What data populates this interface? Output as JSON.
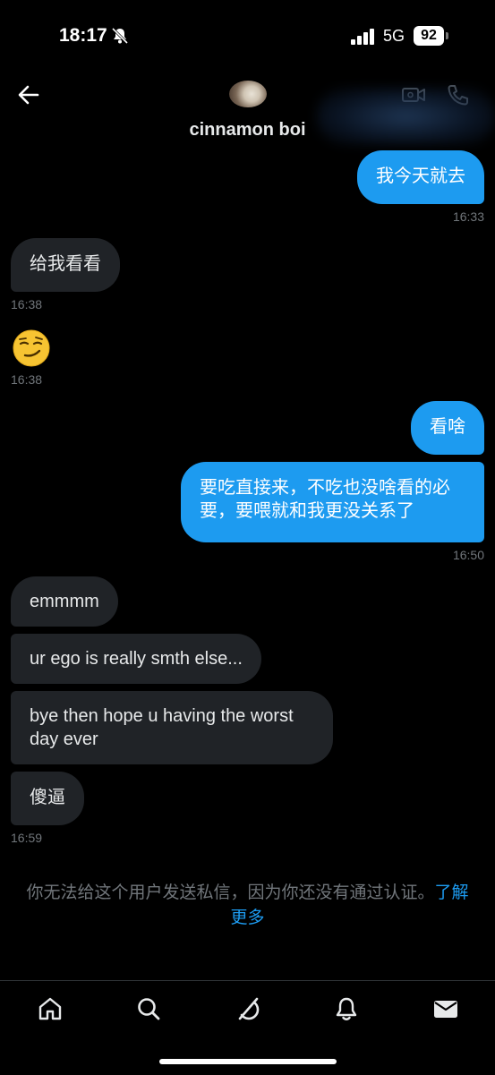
{
  "status_bar": {
    "time": "18:17",
    "network": "5G",
    "battery": "92"
  },
  "header": {
    "contact_name": "cinnamon boi"
  },
  "messages": [
    {
      "text": "我今天就去",
      "time": "16:33"
    },
    {
      "text": "给我看看",
      "time": "16:38"
    },
    {
      "text": "😏",
      "time": "16:38"
    },
    {
      "text": "看啥"
    },
    {
      "line1": "要吃直接来，不吃也没啥看的必",
      "line2": "要，要喂就和我更没关系了",
      "time": "16:50"
    },
    {
      "text": "emmmm"
    },
    {
      "text": "ur ego is really smth else..."
    },
    {
      "line1": "bye then hope u having the worst",
      "line2": "day ever"
    },
    {
      "text": "傻逼",
      "time": "16:59"
    }
  ],
  "notice": {
    "line1": "你无法给这个用户发送私信，因为你还没有通过认证。",
    "link1": "了解",
    "link2": "更多"
  },
  "nav": [
    "home-icon",
    "search-icon",
    "grok-icon",
    "notifications-icon",
    "messages-icon"
  ],
  "colors": {
    "accent": "#1d9bf0",
    "incoming_bubble": "#202327",
    "background": "#000000",
    "muted": "#71767b"
  }
}
